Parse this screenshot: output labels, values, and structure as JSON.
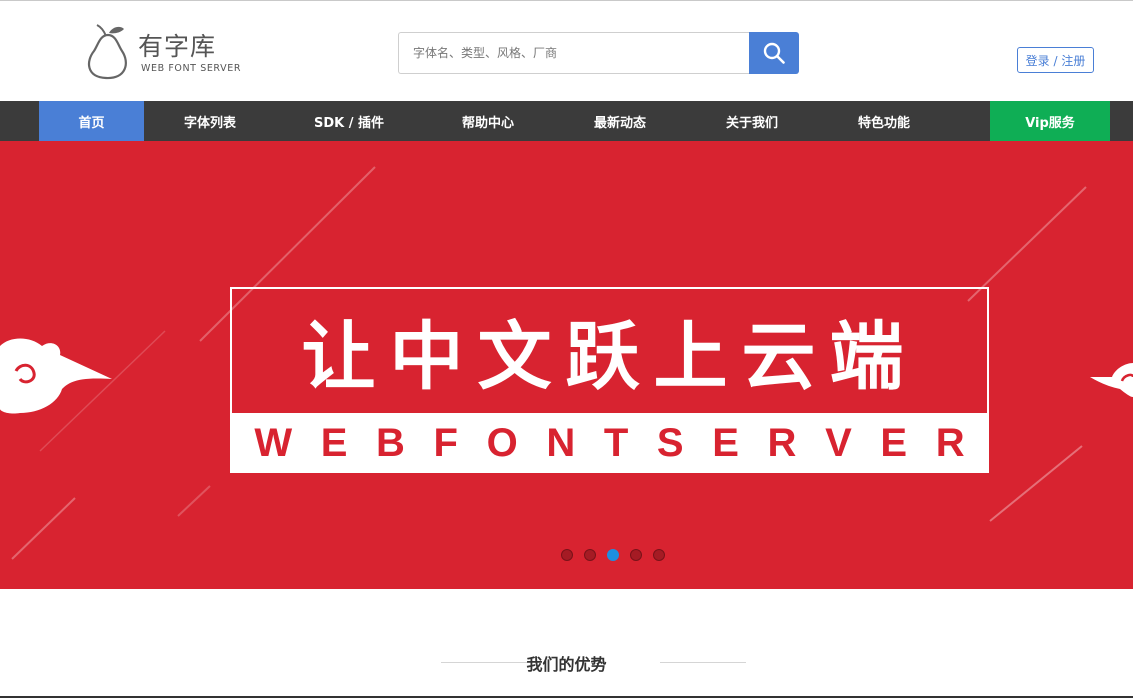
{
  "header": {
    "logo_title": "有字库",
    "logo_subtitle": "WEB FONT SERVER",
    "search": {
      "placeholder": "字体名、类型、风格、厂商",
      "value": "",
      "icon": "search-icon"
    },
    "login_label": "登录 / 注册"
  },
  "nav": {
    "items": [
      {
        "label": "首页"
      },
      {
        "label": "字体列表"
      },
      {
        "label": "SDK / 插件"
      },
      {
        "label": "帮助中心"
      },
      {
        "label": "最新动态"
      },
      {
        "label": "关于我们"
      },
      {
        "label": "特色功能"
      },
      {
        "label": "Vip服务"
      }
    ],
    "active_index": 0
  },
  "banner": {
    "slogan_cn": "让中文跃上云端",
    "slogan_en_letters": [
      "W",
      "E",
      "B",
      "F",
      "O",
      "N",
      "T",
      "S",
      "E",
      "R",
      "V",
      "E",
      "R"
    ],
    "background_color": "#d82330",
    "carousel": {
      "count": 5,
      "active_index": 2
    }
  },
  "section": {
    "title": "我们的优势"
  },
  "colors": {
    "accent_blue": "#4a7fd6",
    "vip_green": "#0fae55",
    "nav_bg": "#3b3b3b",
    "banner_red": "#d82330"
  }
}
